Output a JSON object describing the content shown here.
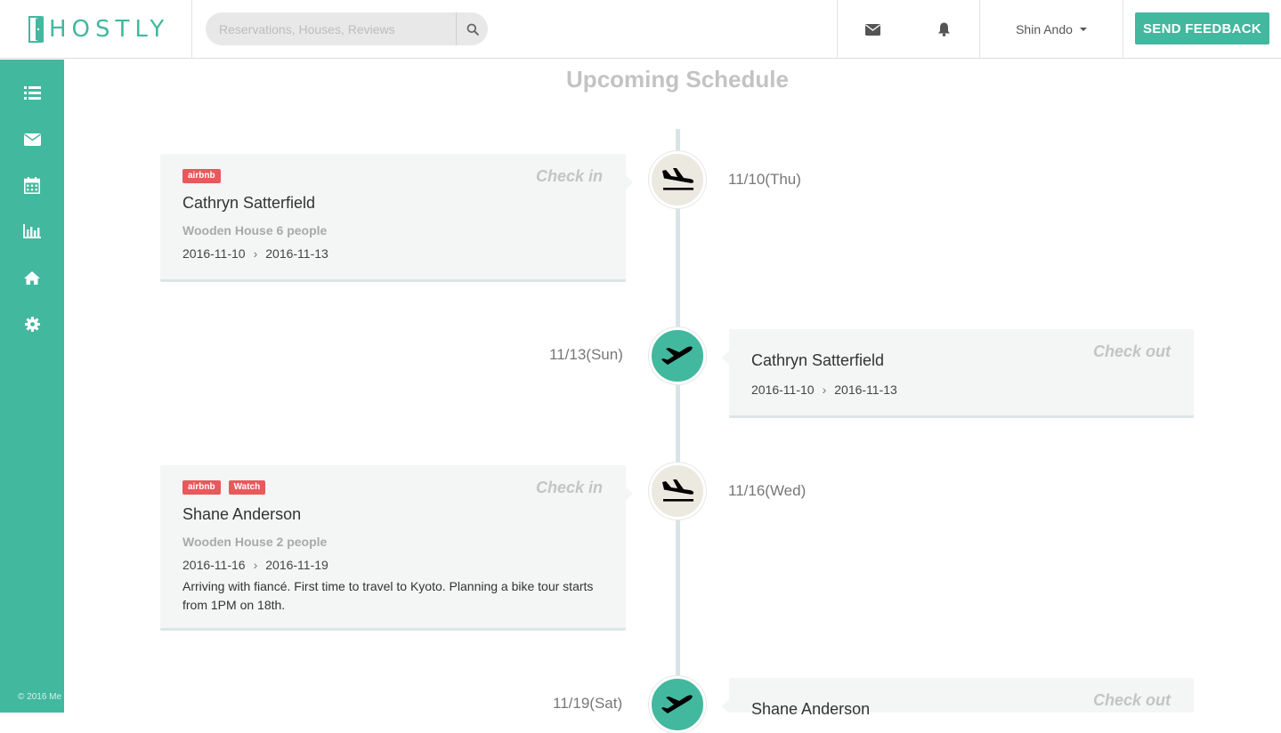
{
  "header": {
    "logo_text": "HOSTLY",
    "search_placeholder": "Reservations, Houses, Reviews",
    "user_name": "Shin Ando",
    "feedback_label": "SEND FEEDBACK",
    "icons": [
      "mail-icon",
      "bell-icon",
      "search-icon"
    ]
  },
  "sidebar": {
    "items": [
      {
        "icon": "list-icon"
      },
      {
        "icon": "mail-icon"
      },
      {
        "icon": "calendar-icon"
      },
      {
        "icon": "bar-chart-icon"
      },
      {
        "icon": "home-icon"
      },
      {
        "icon": "gear-icon"
      }
    ],
    "copyright": "© 2016 Me"
  },
  "main": {
    "title": "Upcoming Schedule",
    "events": [
      {
        "type": "Check in",
        "date": "11/10(Thu)",
        "badges": [
          "airbnb"
        ],
        "guest": "Cathryn Satterfield",
        "house": "Wooden House 6 people",
        "start": "2016-11-10",
        "end": "2016-11-13",
        "note": ""
      },
      {
        "type": "Check out",
        "date": "11/13(Sun)",
        "guest": "Cathryn Satterfield",
        "start": "2016-11-10",
        "end": "2016-11-13"
      },
      {
        "type": "Check in",
        "date": "11/16(Wed)",
        "badges": [
          "airbnb",
          "Watch"
        ],
        "guest": "Shane Anderson",
        "house": "Wooden House 2 people",
        "start": "2016-11-16",
        "end": "2016-11-19",
        "note": "Arriving with fiancé. First time to travel to Kyoto. Planning a bike tour starts from 1PM on 18th."
      },
      {
        "type": "Check out",
        "date": "11/19(Sat)",
        "guest": "Shane Anderson"
      }
    ],
    "date_separator": "›"
  },
  "colors": {
    "brand": "#42b89f",
    "badge": "#e8595c",
    "checkin_node": "#ece9e1",
    "checkout_node": "#42b89f"
  }
}
